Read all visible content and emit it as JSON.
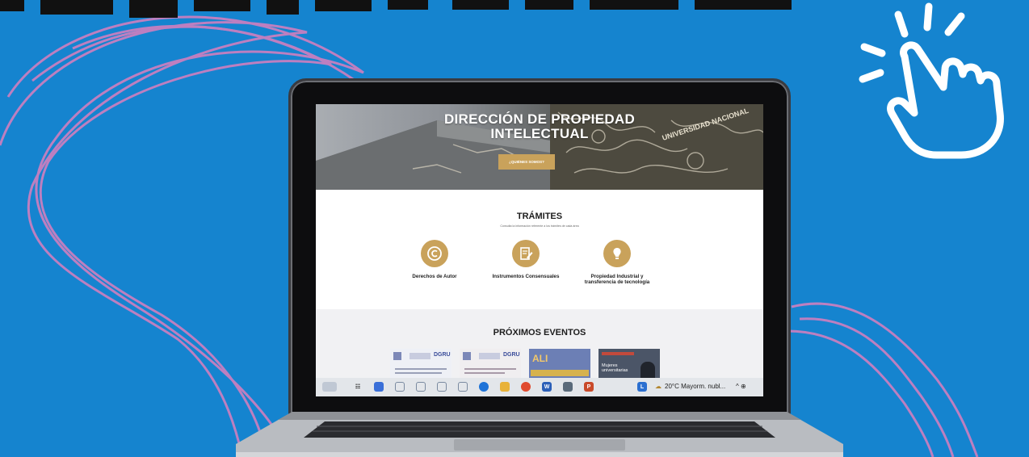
{
  "hero": {
    "title_line1": "DIRECCIÓN DE PROPIEDAD",
    "title_line2": "INTELECTUAL",
    "button_label": "¿QUIÉNES SOMOS?"
  },
  "tramites": {
    "title": "TRÁMITES",
    "subtitle": "Consulta la información referente a los trámites de cada área",
    "items": [
      {
        "label": "Derechos de Autor",
        "icon": "copyright-icon"
      },
      {
        "label": "Instrumentos Consensuales",
        "icon": "document-pen-icon"
      },
      {
        "label_line1": "Propiedad Industrial y",
        "label_line2": "transferencia de tecnología",
        "icon": "lightbulb-icon"
      }
    ]
  },
  "eventos": {
    "title": "PRÓXIMOS EVENTOS",
    "posters": [
      {
        "brand": "DGRU"
      },
      {
        "brand": "DGRU"
      },
      {
        "brand": "ALI"
      },
      {
        "brand": "Mujeres universitarias"
      }
    ]
  },
  "taskbar": {
    "weather": "20°C Mayorm. nubl...",
    "tray": "^ ⊕"
  },
  "colors": {
    "background": "#1584cf",
    "accent_gold": "#c9a25b",
    "deco_pink": "#c77fc0"
  }
}
